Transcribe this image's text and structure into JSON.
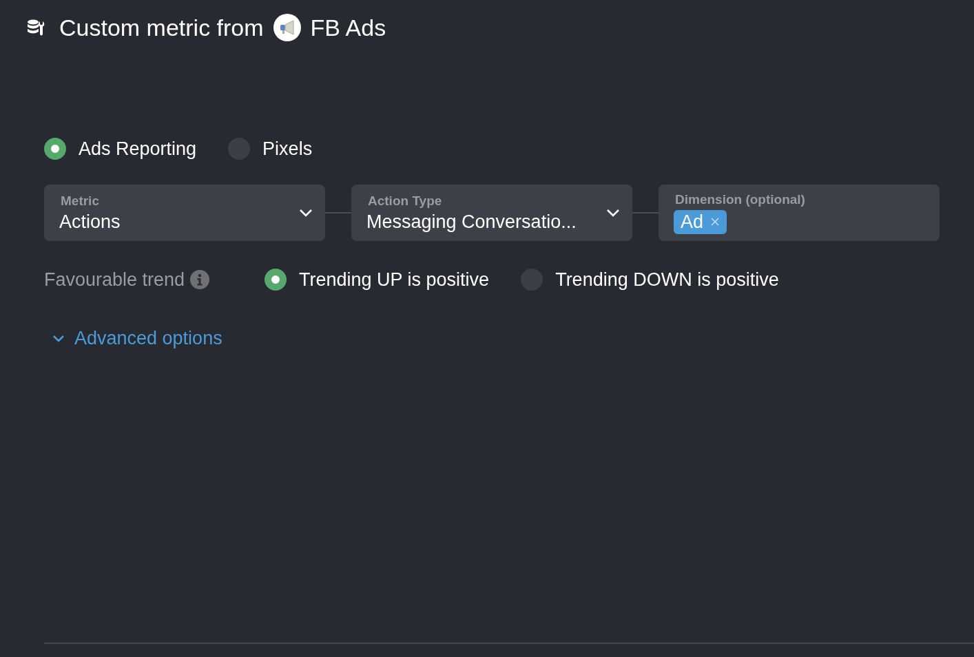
{
  "header": {
    "title": "Custom metric from",
    "source": "FB Ads"
  },
  "source_type": [
    {
      "label": "Ads Reporting",
      "selected": true
    },
    {
      "label": "Pixels",
      "selected": false
    }
  ],
  "fields": [
    {
      "kind": "select",
      "label": "Metric",
      "value": "Actions"
    },
    {
      "kind": "select",
      "label": "Action Type",
      "value": "Messaging Conversatio..."
    },
    {
      "kind": "tags",
      "label": "Dimension (optional)",
      "tags": [
        "Ad"
      ]
    }
  ],
  "favourable_trend": {
    "label": "Favourable trend",
    "options": [
      {
        "label": "Trending UP is positive",
        "selected": true
      },
      {
        "label": "Trending DOWN is positive",
        "selected": false
      }
    ]
  },
  "advanced_options": {
    "label": "Advanced options",
    "expanded": false
  }
}
